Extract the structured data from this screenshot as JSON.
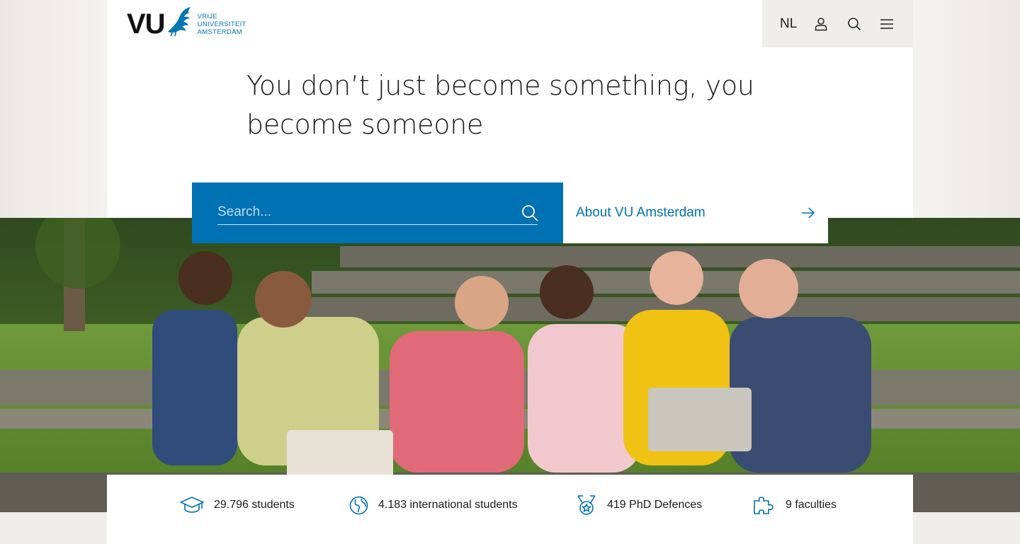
{
  "header": {
    "logo": {
      "mark": "VU",
      "wordmark_lines": [
        "VRIJE",
        "UNIVERSITEIT",
        "AMSTERDAM"
      ]
    },
    "tools": {
      "language": "NL",
      "account_icon": "user-icon",
      "search_icon": "search-icon",
      "menu_icon": "hamburger-menu-icon"
    }
  },
  "hero": {
    "title_line1": "You don’t just become something, you",
    "title_line2": "become someone"
  },
  "search": {
    "placeholder": "Search...",
    "icon": "search-icon"
  },
  "about_link": {
    "label": "About VU Amsterdam",
    "icon": "arrow-right-icon"
  },
  "stats": [
    {
      "icon": "graduation-cap-icon",
      "label": "29.796 students"
    },
    {
      "icon": "globe-icon",
      "label": "4.183 international students"
    },
    {
      "icon": "medal-icon",
      "label": "419 PhD Defences"
    },
    {
      "icon": "puzzle-icon",
      "label": "9 faculties"
    }
  ],
  "colors": {
    "brand_blue": "#0071b3",
    "page_bg": "#efedea",
    "text_dark": "#1a1a1a"
  }
}
